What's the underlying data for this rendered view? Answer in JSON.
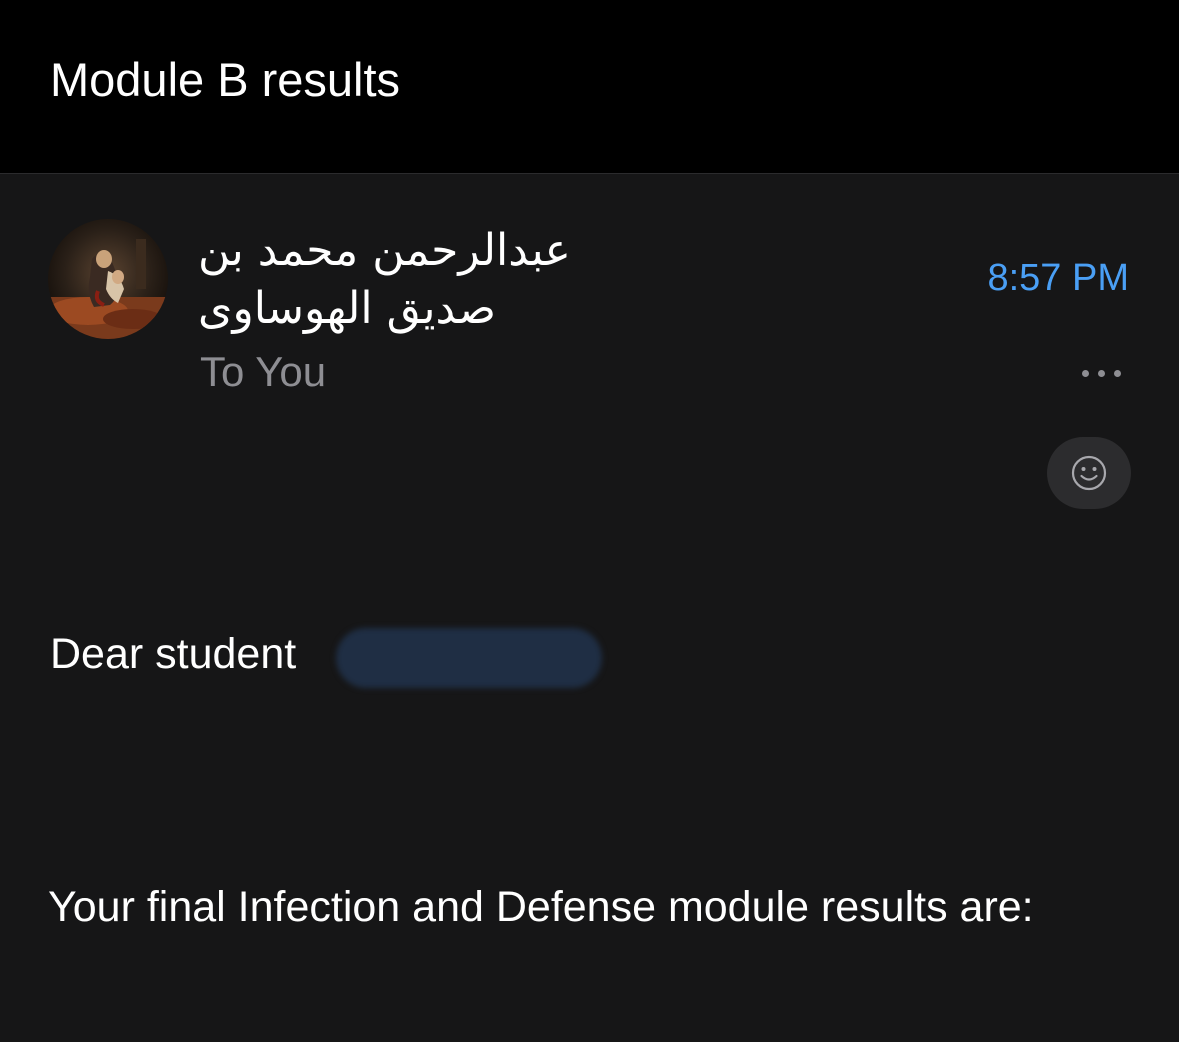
{
  "header": {
    "subject": "Module B results"
  },
  "message": {
    "sender_line1": "عبدالرحمن محمد بن",
    "sender_line2": "صديق الهوساوى",
    "recipient": "To You",
    "time": "8:57 PM",
    "greeting": "Dear student",
    "body": "Your final Infection and Defense module results are:"
  },
  "icons": {
    "avatar": "avatar-painting",
    "more": "more-dots-icon",
    "reaction": "smiley-icon"
  },
  "colors": {
    "background": "#161617",
    "header_background": "#000000",
    "time_accent": "#4a9ff5",
    "secondary_text": "#8e8e93",
    "reaction_button": "#2c2c2e"
  }
}
